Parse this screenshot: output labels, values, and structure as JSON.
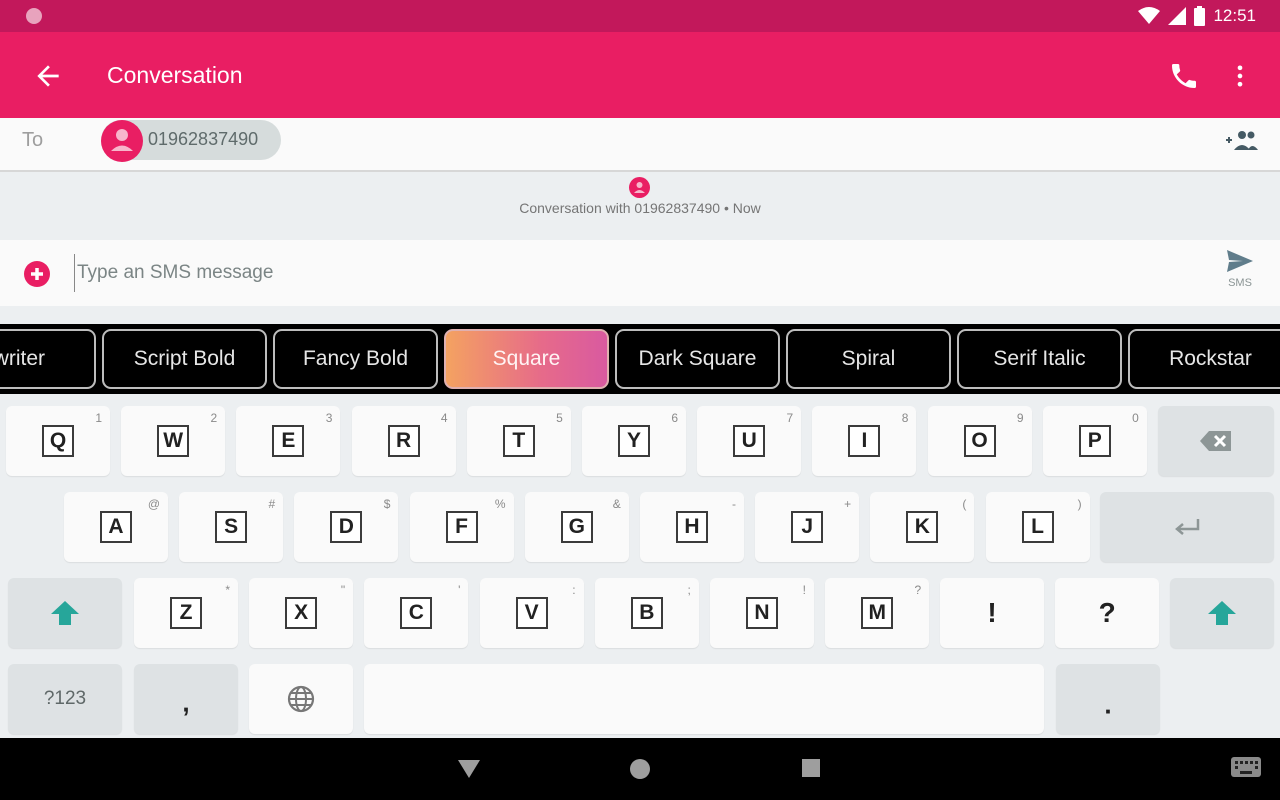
{
  "status_bar": {
    "time": "12:51",
    "icons": [
      "notification-dot-icon",
      "wifi-icon",
      "signal-icon",
      "battery-icon"
    ]
  },
  "app_bar": {
    "title": "Conversation",
    "icons": [
      "back-arrow-icon",
      "phone-icon",
      "more-vert-icon"
    ]
  },
  "recipient": {
    "to_label": "To",
    "chip_number": "01962837490",
    "add_people_icon": "add-people-icon"
  },
  "conversation": {
    "info": "Conversation with 01962837490 • Now"
  },
  "compose": {
    "placeholder": "Type an SMS message",
    "value": "",
    "send_label": "SMS"
  },
  "font_styles": {
    "selected": "Square",
    "items": [
      "ewriter",
      "Script Bold",
      "Fancy Bold",
      "Square",
      "Dark Square",
      "Spiral",
      "Serif Italic",
      "Rockstar"
    ]
  },
  "keyboard": {
    "row1": [
      {
        "key": "Q",
        "hint": "1"
      },
      {
        "key": "W",
        "hint": "2"
      },
      {
        "key": "E",
        "hint": "3"
      },
      {
        "key": "R",
        "hint": "4"
      },
      {
        "key": "T",
        "hint": "5"
      },
      {
        "key": "Y",
        "hint": "6"
      },
      {
        "key": "U",
        "hint": "7"
      },
      {
        "key": "I",
        "hint": "8"
      },
      {
        "key": "O",
        "hint": "9"
      },
      {
        "key": "P",
        "hint": "0"
      }
    ],
    "row2": [
      {
        "key": "A",
        "hint": "@"
      },
      {
        "key": "S",
        "hint": "#"
      },
      {
        "key": "D",
        "hint": "$"
      },
      {
        "key": "F",
        "hint": "%"
      },
      {
        "key": "G",
        "hint": "&"
      },
      {
        "key": "H",
        "hint": "-"
      },
      {
        "key": "J",
        "hint": "+"
      },
      {
        "key": "K",
        "hint": "("
      },
      {
        "key": "L",
        "hint": ")"
      }
    ],
    "row3": [
      {
        "key": "Z",
        "hint": "*"
      },
      {
        "key": "X",
        "hint": "\""
      },
      {
        "key": "C",
        "hint": "'"
      },
      {
        "key": "V",
        "hint": ":"
      },
      {
        "key": "B",
        "hint": ";"
      },
      {
        "key": "N",
        "hint": "!"
      },
      {
        "key": "M",
        "hint": "?"
      }
    ],
    "row3_extra": [
      "!",
      "?"
    ],
    "symbols_label": "?123",
    "comma": ",",
    "period": ".",
    "shift_color": "#26a69a"
  },
  "colors": {
    "primary": "#e91e63",
    "primary_dark": "#c2185b"
  }
}
